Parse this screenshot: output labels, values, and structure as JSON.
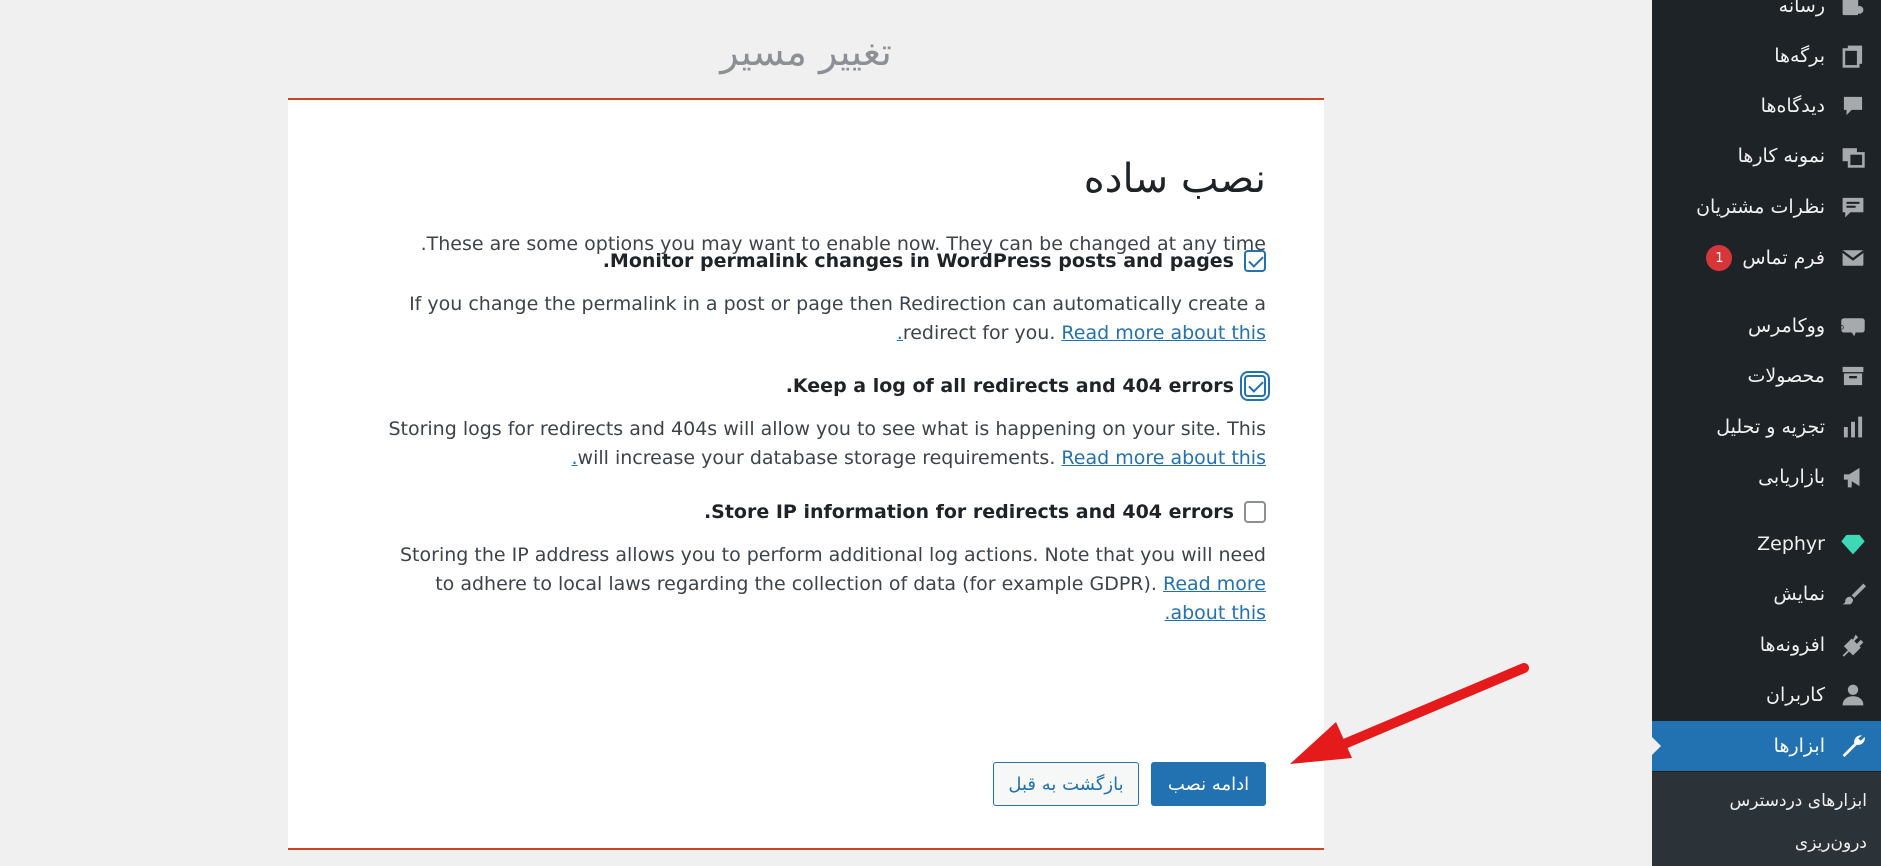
{
  "page": {
    "title": "تغییر مسیر"
  },
  "card": {
    "heading": "نصب ساده",
    "intro": "These are some options you may want to enable now. They can be changed at any time.",
    "options": [
      {
        "label": "Monitor permalink changes in WordPress posts and pages.",
        "checked": true,
        "description": "If you change the permalink in a post or page then Redirection can automatically create a redirect for you.",
        "link": "Read more about this."
      },
      {
        "label": "Keep a log of all redirects and 404 errors.",
        "checked": true,
        "description": "Storing logs for redirects and 404s will allow you to see what is happening on your site. This will increase your database storage requirements.",
        "link": "Read more about this."
      },
      {
        "label": "Store IP information for redirects and 404 errors.",
        "checked": false,
        "description": "Storing the IP address allows you to perform additional log actions. Note that you will need to adhere to local laws regarding the collection of data (for example GDPR).",
        "link": "Read more about this."
      }
    ],
    "buttons": {
      "continue": "ادامه نصب",
      "back": "بازگشت به قبل"
    }
  },
  "sidebar": {
    "items": [
      {
        "label": "رسانه",
        "icon": "media-icon"
      },
      {
        "label": "برگه‌ها",
        "icon": "pages-icon"
      },
      {
        "label": "دیدگاه‌ها",
        "icon": "comments-icon"
      },
      {
        "label": "نمونه کارها",
        "icon": "portfolio-icon"
      },
      {
        "label": "نظرات مشتریان",
        "icon": "testimonial-icon"
      },
      {
        "label": "فرم تماس",
        "icon": "mail-icon",
        "badge": "1"
      },
      {
        "label": "ووکامرس",
        "icon": "woocommerce-icon"
      },
      {
        "label": "محصولات",
        "icon": "archive-icon"
      },
      {
        "label": "تجزیه و تحلیل",
        "icon": "chart-bar-icon"
      },
      {
        "label": "بازاریابی",
        "icon": "megaphone-icon"
      },
      {
        "label": "Zephyr",
        "icon": "diamond-icon"
      },
      {
        "label": "نمایش",
        "icon": "brush-icon"
      },
      {
        "label": "افزونه‌ها",
        "icon": "plugin-icon"
      },
      {
        "label": "کاربران",
        "icon": "user-icon"
      },
      {
        "label": "ابزارها",
        "icon": "wrench-icon",
        "active": true
      }
    ],
    "submenu": [
      {
        "label": "ابزارهای دردسترس"
      },
      {
        "label": "درون‌ریزی"
      }
    ]
  },
  "colors": {
    "sidebar_bg": "#1d2327",
    "accent": "#2271b1",
    "card_border": "#c9461e",
    "arrow": "#e51b1b",
    "badge": "#d63638"
  }
}
